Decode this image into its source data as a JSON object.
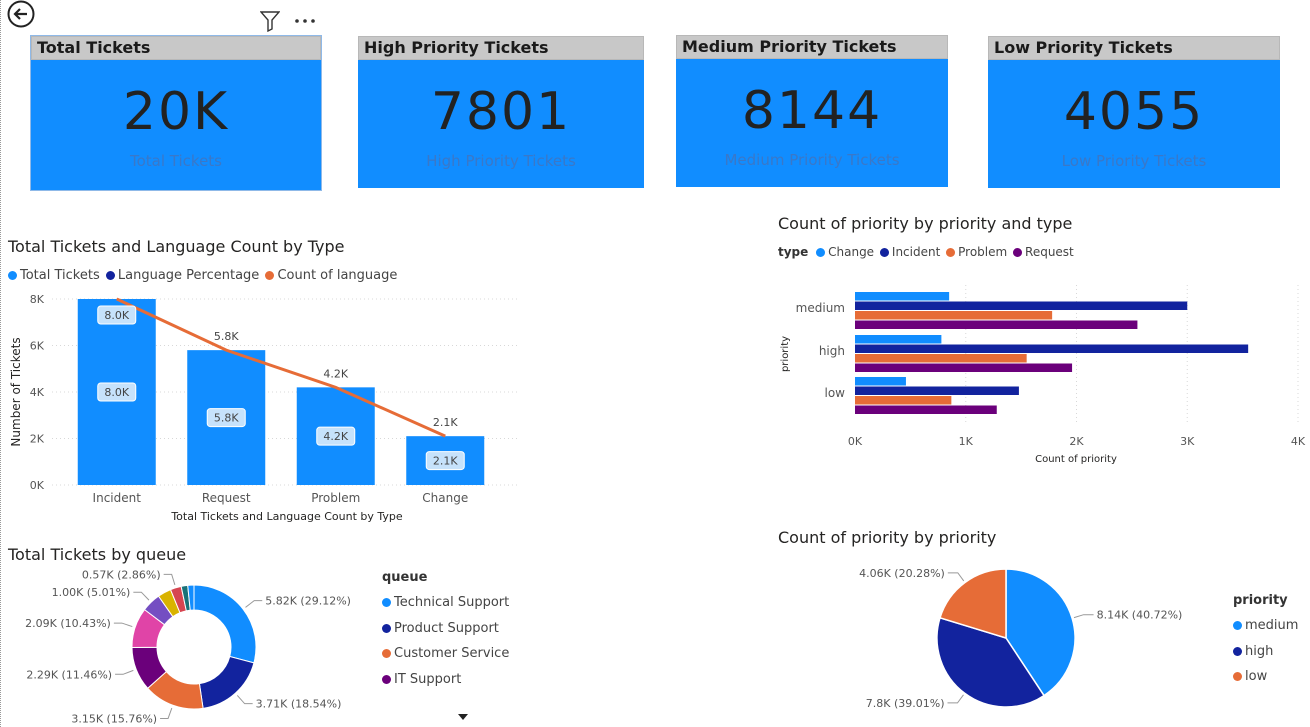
{
  "toolbar": {
    "back_icon": "back-arrow-icon",
    "filter_icon": "filter-icon",
    "more_icon": "more-options-icon"
  },
  "cards": [
    {
      "header": "Total Tickets",
      "value": "20K",
      "sub": "Total Tickets"
    },
    {
      "header": "High Priority Tickets",
      "value": "7801",
      "sub": "High Priority Tickets"
    },
    {
      "header": "Medium Priority Tickets",
      "value": "8144",
      "sub": "Medium Priority Tickets"
    },
    {
      "header": "Low Priority Tickets",
      "value": "4055",
      "sub": "Low Priority Tickets"
    }
  ],
  "colors": {
    "accent": "#118dff",
    "dark_blue": "#12239e",
    "orange": "#e66c37",
    "purple": "#6b007b",
    "pink": "#e044a7",
    "violet": "#744ec2",
    "yellow": "#d9b300",
    "red": "#d64550",
    "green": "#197278"
  },
  "chart_data": [
    {
      "type": "bar",
      "title": "Total Tickets and Language Count by Type",
      "legend": [
        "Total Tickets",
        "Language Percentage",
        "Count of language"
      ],
      "categories": [
        "Incident",
        "Request",
        "Problem",
        "Change"
      ],
      "series": [
        {
          "name": "Total Tickets",
          "values": [
            8000,
            5800,
            4200,
            2100
          ],
          "labels": [
            "8.0K",
            "5.8K",
            "4.2K",
            "2.1K"
          ]
        },
        {
          "name": "Count of language",
          "values": [
            8000,
            5800,
            4200,
            2100
          ],
          "labels": [
            "8.0K",
            "5.8K",
            "4.2K",
            "2.1K"
          ]
        }
      ],
      "xlabel": "Total Tickets and Language Count by Type",
      "ylabel": "Number of Tickets",
      "yticks": [
        "0K",
        "2K",
        "4K",
        "6K",
        "8K"
      ],
      "ylim": [
        0,
        8000
      ]
    },
    {
      "type": "bar",
      "orientation": "horizontal",
      "title": "Count of priority by priority and type",
      "legend_title": "type",
      "legend": [
        "Change",
        "Incident",
        "Problem",
        "Request"
      ],
      "categories": [
        "medium",
        "high",
        "low"
      ],
      "series": [
        {
          "name": "Change",
          "values": [
            850,
            780,
            460
          ]
        },
        {
          "name": "Incident",
          "values": [
            3000,
            3550,
            1480
          ]
        },
        {
          "name": "Problem",
          "values": [
            1780,
            1550,
            870
          ]
        },
        {
          "name": "Request",
          "values": [
            2550,
            1960,
            1280
          ]
        }
      ],
      "xlabel": "Count of priority",
      "ylabel": "priority",
      "xticks": [
        "0K",
        "1K",
        "2K",
        "3K",
        "4K"
      ],
      "xlim": [
        0,
        4000
      ]
    },
    {
      "type": "pie",
      "subtype": "donut",
      "title": "Total Tickets by queue",
      "legend_title": "queue",
      "legend": [
        "Technical Support",
        "Product Support",
        "Customer Service",
        "IT Support"
      ],
      "slices": [
        {
          "label": "Technical Support",
          "value": 29.12,
          "text": "5.82K (29.12%)"
        },
        {
          "label": "Product Support",
          "value": 18.54,
          "text": "3.71K (18.54%)"
        },
        {
          "label": "Customer Service",
          "value": 15.76,
          "text": "3.15K (15.76%)"
        },
        {
          "label": "IT Support",
          "value": 11.46,
          "text": "2.29K (11.46%)"
        },
        {
          "label": "",
          "value": 10.43,
          "text": "2.09K (10.43%)"
        },
        {
          "label": "",
          "value": 5.01,
          "text": "1.00K (5.01%)"
        },
        {
          "label": "",
          "value": 3.5,
          "text": ""
        },
        {
          "label": "",
          "value": 2.86,
          "text": "0.57K (2.86%)"
        },
        {
          "label": "",
          "value": 1.7,
          "text": ""
        },
        {
          "label": "",
          "value": 1.62,
          "text": ""
        }
      ]
    },
    {
      "type": "pie",
      "title": "Count of priority by priority",
      "legend_title": "priority",
      "legend": [
        "medium",
        "high",
        "low"
      ],
      "slices": [
        {
          "label": "medium",
          "value": 40.72,
          "text": "8.14K (40.72%)"
        },
        {
          "label": "high",
          "value": 39.01,
          "text": "7.8K (39.01%)"
        },
        {
          "label": "low",
          "value": 20.28,
          "text": "4.06K (20.28%)"
        }
      ]
    }
  ]
}
